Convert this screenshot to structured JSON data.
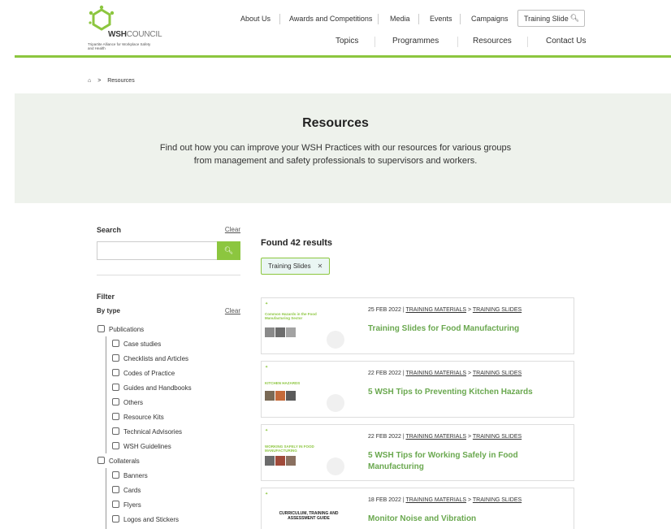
{
  "header": {
    "logo": {
      "brand_bold": "WSH",
      "brand_light": "COUNCIL",
      "tagline": "Tripartite Alliance for Workplace Safety and Health"
    },
    "top_nav": [
      "About Us",
      "Awards and Competitions",
      "Media",
      "Events",
      "Campaigns"
    ],
    "search_value": "Training Slide",
    "main_nav": [
      "Topics",
      "Programmes",
      "Resources",
      "Contact Us"
    ]
  },
  "breadcrumb": {
    "separator": ">",
    "current": "Resources"
  },
  "hero": {
    "title": "Resources",
    "description": "Find out how you can improve your WSH Practices with our resources for various groups from management and safety professionals to supervisors and workers."
  },
  "sidebar": {
    "search_title": "Search",
    "clear_label": "Clear",
    "search_placeholder": "",
    "filter_title": "Filter",
    "by_type_label": "By type",
    "by_type_clear": "Clear",
    "groups": [
      {
        "label": "Publications",
        "children": [
          "Case studies",
          "Checklists and Articles",
          "Codes of Practice",
          "Guides and Handbooks",
          "Others",
          "Resource Kits",
          "Technical Advisories",
          "WSH Guidelines"
        ]
      },
      {
        "label": "Collaterals",
        "children": [
          "Banners",
          "Cards",
          "Flyers",
          "Logos and Stickers"
        ]
      }
    ]
  },
  "results": {
    "found_text": "Found 42 results",
    "active_filter": "Training Slides",
    "items": [
      {
        "date": "25 FEB 2022",
        "category": "TRAINING MATERIALS",
        "subcategory": "TRAINING SLIDES",
        "title": "Training Slides for Food Manufacturing",
        "thumb_title": "Common Hazards in the Food Manufacturing Sector"
      },
      {
        "date": "22 FEB 2022",
        "category": "TRAINING MATERIALS",
        "subcategory": "TRAINING SLIDES",
        "title": "5 WSH Tips to Preventing Kitchen Hazards",
        "thumb_title": "KITCHEN HAZARDS"
      },
      {
        "date": "22 FEB 2022",
        "category": "TRAINING MATERIALS",
        "subcategory": "TRAINING SLIDES",
        "title": "5 WSH Tips for Working Safely in Food Manufacturing",
        "thumb_title": "WORKING SAFELY IN FOOD MANUFACTURING"
      },
      {
        "date": "18 FEB 2022",
        "category": "TRAINING MATERIALS",
        "subcategory": "TRAINING SLIDES",
        "title": "Monitor Noise and Vibration",
        "thumb_title": "CURRICULUM, TRAINING AND ASSESSMENT GUIDE"
      }
    ]
  },
  "colors": {
    "accent_green": "#8cc63f",
    "title_green": "#6aa84f",
    "hero_bg": "#eef2ec"
  }
}
